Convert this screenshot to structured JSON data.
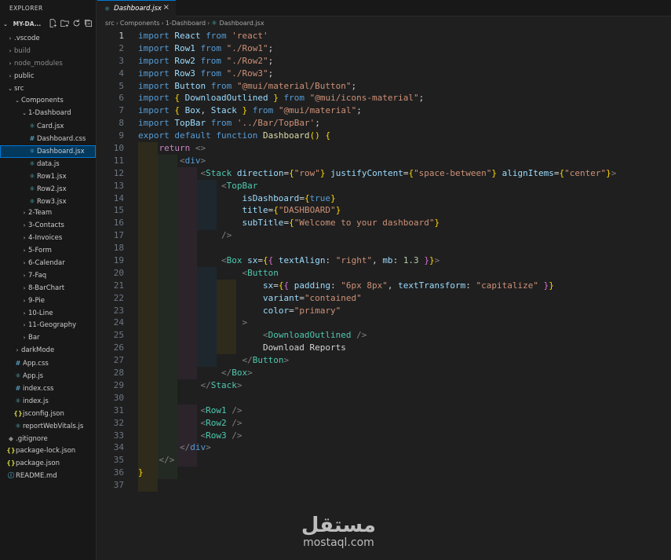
{
  "sidebar": {
    "title": "EXPLORER",
    "project": "MY-DA...",
    "items": [
      {
        "label": ".vscode",
        "kind": "folder",
        "depth": 0,
        "open": false,
        "icon": "chevron-right-icon"
      },
      {
        "label": "build",
        "kind": "folder",
        "depth": 0,
        "open": false,
        "icon": "chevron-right-icon",
        "dim": true
      },
      {
        "label": "node_modules",
        "kind": "folder",
        "depth": 0,
        "open": false,
        "icon": "chevron-right-icon",
        "dim": true
      },
      {
        "label": "public",
        "kind": "folder",
        "depth": 0,
        "open": false,
        "icon": "chevron-right-icon"
      },
      {
        "label": "src",
        "kind": "folder",
        "depth": 0,
        "open": true,
        "icon": "chevron-down-icon"
      },
      {
        "label": "Components",
        "kind": "folder",
        "depth": 1,
        "open": true,
        "icon": "chevron-down-icon"
      },
      {
        "label": "1-Dashboard",
        "kind": "folder",
        "depth": 2,
        "open": true,
        "icon": "chevron-down-icon"
      },
      {
        "label": "Card.jsx",
        "kind": "file",
        "depth": 3,
        "ftype": "react"
      },
      {
        "label": "Dashboard.css",
        "kind": "file",
        "depth": 3,
        "ftype": "css"
      },
      {
        "label": "Dashboard.jsx",
        "kind": "file",
        "depth": 3,
        "ftype": "react",
        "selected": true
      },
      {
        "label": "data.js",
        "kind": "file",
        "depth": 3,
        "ftype": "react"
      },
      {
        "label": "Row1.jsx",
        "kind": "file",
        "depth": 3,
        "ftype": "react"
      },
      {
        "label": "Row2.jsx",
        "kind": "file",
        "depth": 3,
        "ftype": "react"
      },
      {
        "label": "Row3.jsx",
        "kind": "file",
        "depth": 3,
        "ftype": "react"
      },
      {
        "label": "2-Team",
        "kind": "folder",
        "depth": 2,
        "open": false,
        "icon": "chevron-right-icon"
      },
      {
        "label": "3-Contacts",
        "kind": "folder",
        "depth": 2,
        "open": false,
        "icon": "chevron-right-icon"
      },
      {
        "label": "4-Invoices",
        "kind": "folder",
        "depth": 2,
        "open": false,
        "icon": "chevron-right-icon"
      },
      {
        "label": "5-Form",
        "kind": "folder",
        "depth": 2,
        "open": false,
        "icon": "chevron-right-icon"
      },
      {
        "label": "6-Calendar",
        "kind": "folder",
        "depth": 2,
        "open": false,
        "icon": "chevron-right-icon"
      },
      {
        "label": "7-Faq",
        "kind": "folder",
        "depth": 2,
        "open": false,
        "icon": "chevron-right-icon"
      },
      {
        "label": "8-BarChart",
        "kind": "folder",
        "depth": 2,
        "open": false,
        "icon": "chevron-right-icon"
      },
      {
        "label": "9-Pie",
        "kind": "folder",
        "depth": 2,
        "open": false,
        "icon": "chevron-right-icon"
      },
      {
        "label": "10-Line",
        "kind": "folder",
        "depth": 2,
        "open": false,
        "icon": "chevron-right-icon"
      },
      {
        "label": "11-Geography",
        "kind": "folder",
        "depth": 2,
        "open": false,
        "icon": "chevron-right-icon"
      },
      {
        "label": "Bar",
        "kind": "folder",
        "depth": 2,
        "open": false,
        "icon": "chevron-right-icon"
      },
      {
        "label": "darkMode",
        "kind": "folder",
        "depth": 1,
        "open": false,
        "icon": "chevron-right-icon"
      },
      {
        "label": "App.css",
        "kind": "file",
        "depth": 1,
        "ftype": "css"
      },
      {
        "label": "App.js",
        "kind": "file",
        "depth": 1,
        "ftype": "react"
      },
      {
        "label": "index.css",
        "kind": "file",
        "depth": 1,
        "ftype": "css"
      },
      {
        "label": "index.js",
        "kind": "file",
        "depth": 1,
        "ftype": "react"
      },
      {
        "label": "jsconfig.json",
        "kind": "file",
        "depth": 1,
        "ftype": "json"
      },
      {
        "label": "reportWebVitals.js",
        "kind": "file",
        "depth": 1,
        "ftype": "react"
      },
      {
        "label": ".gitignore",
        "kind": "file",
        "depth": 0,
        "ftype": "git"
      },
      {
        "label": "package-lock.json",
        "kind": "file",
        "depth": 0,
        "ftype": "json"
      },
      {
        "label": "package.json",
        "kind": "file",
        "depth": 0,
        "ftype": "json"
      },
      {
        "label": "README.md",
        "kind": "file",
        "depth": 0,
        "ftype": "info"
      }
    ]
  },
  "tab": {
    "label": "Dashboard.jsx",
    "close": "×"
  },
  "breadcrumb": [
    "src",
    "Components",
    "1-Dashboard",
    "Dashboard.jsx"
  ],
  "editor": {
    "active_line": 1,
    "lines": [
      [
        [
          "kw",
          "import "
        ],
        [
          "var",
          "React "
        ],
        [
          "kw",
          "from "
        ],
        [
          "str",
          "'react'"
        ]
      ],
      [
        [
          "kw",
          "import "
        ],
        [
          "var",
          "Row1 "
        ],
        [
          "kw",
          "from "
        ],
        [
          "str",
          "\"./Row1\""
        ],
        [
          "txt",
          ";"
        ]
      ],
      [
        [
          "kw",
          "import "
        ],
        [
          "var",
          "Row2 "
        ],
        [
          "kw",
          "from "
        ],
        [
          "str",
          "\"./Row2\""
        ],
        [
          "txt",
          ";"
        ]
      ],
      [
        [
          "kw",
          "import "
        ],
        [
          "var",
          "Row3 "
        ],
        [
          "kw",
          "from "
        ],
        [
          "str",
          "\"./Row3\""
        ],
        [
          "txt",
          ";"
        ]
      ],
      [
        [
          "kw",
          "import "
        ],
        [
          "var",
          "Button "
        ],
        [
          "kw",
          "from "
        ],
        [
          "str",
          "\"@mui/material/Button\""
        ],
        [
          "txt",
          ";"
        ]
      ],
      [
        [
          "kw",
          "import "
        ],
        [
          "br1",
          "{ "
        ],
        [
          "var",
          "DownloadOutlined "
        ],
        [
          "br1",
          "} "
        ],
        [
          "kw",
          "from "
        ],
        [
          "str",
          "\"@mui/icons-material\""
        ],
        [
          "txt",
          ";"
        ]
      ],
      [
        [
          "kw",
          "import "
        ],
        [
          "br1",
          "{ "
        ],
        [
          "var",
          "Box"
        ],
        [
          "txt",
          ", "
        ],
        [
          "var",
          "Stack "
        ],
        [
          "br1",
          "} "
        ],
        [
          "kw",
          "from "
        ],
        [
          "str",
          "\"@mui/material\""
        ],
        [
          "txt",
          ";"
        ]
      ],
      [
        [
          "kw",
          "import "
        ],
        [
          "var",
          "TopBar "
        ],
        [
          "kw",
          "from "
        ],
        [
          "str",
          "'../Bar/TopBar'"
        ],
        [
          "txt",
          ";"
        ]
      ],
      [
        [
          "kw",
          "export "
        ],
        [
          "kw",
          "default "
        ],
        [
          "kw",
          "function "
        ],
        [
          "fn",
          "Dashboard"
        ],
        [
          "br1",
          "() "
        ],
        [
          "br1",
          "{"
        ]
      ],
      [
        [
          "txt",
          "    "
        ],
        [
          "ctl",
          "return "
        ],
        [
          "pun",
          "<>"
        ]
      ],
      [
        [
          "txt",
          "        "
        ],
        [
          "pun",
          "<"
        ],
        [
          "html",
          "div"
        ],
        [
          "pun",
          ">"
        ]
      ],
      [
        [
          "txt",
          "            "
        ],
        [
          "pun",
          "<"
        ],
        [
          "tag",
          "Stack "
        ],
        [
          "var",
          "direction"
        ],
        [
          "txt",
          "="
        ],
        [
          "br1",
          "{"
        ],
        [
          "str",
          "\"row\""
        ],
        [
          "br1",
          "} "
        ],
        [
          "var",
          "justifyContent"
        ],
        [
          "txt",
          "="
        ],
        [
          "br1",
          "{"
        ],
        [
          "str",
          "\"space-between\""
        ],
        [
          "br1",
          "} "
        ],
        [
          "var",
          "alignItems"
        ],
        [
          "txt",
          "="
        ],
        [
          "br1",
          "{"
        ],
        [
          "str",
          "\"center\""
        ],
        [
          "br1",
          "}"
        ],
        [
          "pun",
          ">"
        ]
      ],
      [
        [
          "txt",
          "                "
        ],
        [
          "pun",
          "<"
        ],
        [
          "tag",
          "TopBar"
        ]
      ],
      [
        [
          "txt",
          "                    "
        ],
        [
          "var",
          "isDashboard"
        ],
        [
          "txt",
          "="
        ],
        [
          "br1",
          "{"
        ],
        [
          "kw",
          "true"
        ],
        [
          "br1",
          "}"
        ]
      ],
      [
        [
          "txt",
          "                    "
        ],
        [
          "var",
          "title"
        ],
        [
          "txt",
          "="
        ],
        [
          "br1",
          "{"
        ],
        [
          "str",
          "\"DASHBOARD\""
        ],
        [
          "br1",
          "}"
        ]
      ],
      [
        [
          "txt",
          "                    "
        ],
        [
          "var",
          "subTitle"
        ],
        [
          "txt",
          "="
        ],
        [
          "br1",
          "{"
        ],
        [
          "str",
          "\"Welcome to your dashboard\""
        ],
        [
          "br1",
          "}"
        ]
      ],
      [
        [
          "txt",
          "                "
        ],
        [
          "pun",
          "/>"
        ]
      ],
      [
        [
          "txt",
          ""
        ]
      ],
      [
        [
          "txt",
          "                "
        ],
        [
          "pun",
          "<"
        ],
        [
          "tag",
          "Box "
        ],
        [
          "var",
          "sx"
        ],
        [
          "txt",
          "="
        ],
        [
          "br1",
          "{"
        ],
        [
          "br2",
          "{ "
        ],
        [
          "var",
          "textAlign"
        ],
        [
          "txt",
          ": "
        ],
        [
          "str",
          "\"right\""
        ],
        [
          "txt",
          ", "
        ],
        [
          "var",
          "mb"
        ],
        [
          "txt",
          ": "
        ],
        [
          "num",
          "1.3 "
        ],
        [
          "br2",
          "}"
        ],
        [
          "br1",
          "}"
        ],
        [
          "pun",
          ">"
        ]
      ],
      [
        [
          "txt",
          "                    "
        ],
        [
          "pun",
          "<"
        ],
        [
          "tag",
          "Button"
        ]
      ],
      [
        [
          "txt",
          "                        "
        ],
        [
          "var",
          "sx"
        ],
        [
          "txt",
          "="
        ],
        [
          "br1",
          "{"
        ],
        [
          "br2",
          "{ "
        ],
        [
          "var",
          "padding"
        ],
        [
          "txt",
          ": "
        ],
        [
          "str",
          "\"6px 8px\""
        ],
        [
          "txt",
          ", "
        ],
        [
          "var",
          "textTransform"
        ],
        [
          "txt",
          ": "
        ],
        [
          "str",
          "\"capitalize\" "
        ],
        [
          "br2",
          "}"
        ],
        [
          "br1",
          "}"
        ]
      ],
      [
        [
          "txt",
          "                        "
        ],
        [
          "var",
          "variant"
        ],
        [
          "txt",
          "="
        ],
        [
          "str",
          "\"contained\""
        ]
      ],
      [
        [
          "txt",
          "                        "
        ],
        [
          "var",
          "color"
        ],
        [
          "txt",
          "="
        ],
        [
          "str",
          "\"primary\""
        ]
      ],
      [
        [
          "txt",
          "                    "
        ],
        [
          "pun",
          ">"
        ]
      ],
      [
        [
          "txt",
          "                        "
        ],
        [
          "pun",
          "<"
        ],
        [
          "tag",
          "DownloadOutlined "
        ],
        [
          "pun",
          "/>"
        ]
      ],
      [
        [
          "txt",
          "                        Download Reports"
        ]
      ],
      [
        [
          "txt",
          "                    "
        ],
        [
          "pun",
          "</"
        ],
        [
          "tag",
          "Button"
        ],
        [
          "pun",
          ">"
        ]
      ],
      [
        [
          "txt",
          "                "
        ],
        [
          "pun",
          "</"
        ],
        [
          "tag",
          "Box"
        ],
        [
          "pun",
          ">"
        ]
      ],
      [
        [
          "txt",
          "            "
        ],
        [
          "pun",
          "</"
        ],
        [
          "tag",
          "Stack"
        ],
        [
          "pun",
          ">"
        ]
      ],
      [
        [
          "txt",
          ""
        ]
      ],
      [
        [
          "txt",
          "            "
        ],
        [
          "pun",
          "<"
        ],
        [
          "tag",
          "Row1 "
        ],
        [
          "pun",
          "/>"
        ]
      ],
      [
        [
          "txt",
          "            "
        ],
        [
          "pun",
          "<"
        ],
        [
          "tag",
          "Row2 "
        ],
        [
          "pun",
          "/>"
        ]
      ],
      [
        [
          "txt",
          "            "
        ],
        [
          "pun",
          "<"
        ],
        [
          "tag",
          "Row3 "
        ],
        [
          "pun",
          "/>"
        ]
      ],
      [
        [
          "txt",
          "        "
        ],
        [
          "pun",
          "</"
        ],
        [
          "html",
          "div"
        ],
        [
          "pun",
          ">"
        ]
      ],
      [
        [
          "txt",
          "    "
        ],
        [
          "pun",
          "</>"
        ]
      ],
      [
        [
          "br1",
          "}"
        ]
      ],
      [
        [
          "txt",
          ""
        ]
      ]
    ]
  },
  "watermark": {
    "arabic": "مستقل",
    "latin": "mostaql.com"
  },
  "colors": {
    "accent": "#0078d4",
    "selection": "#04395e",
    "background": "#1f1f1f",
    "sidebar": "#181818"
  }
}
